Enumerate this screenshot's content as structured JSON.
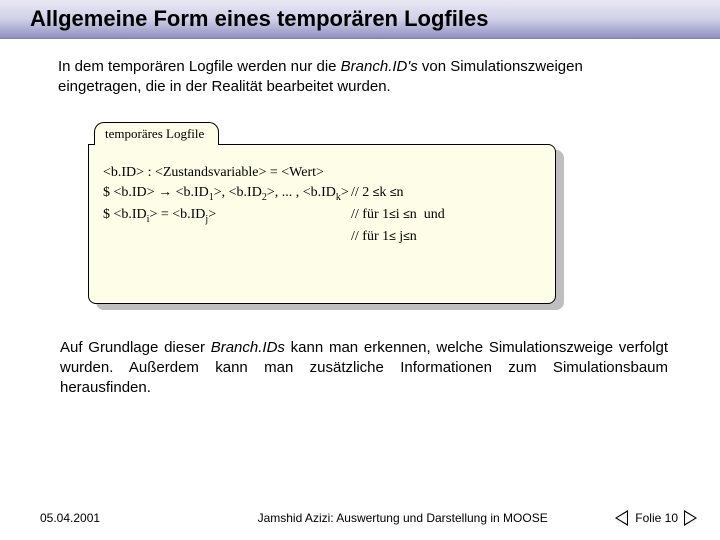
{
  "title": "Allgemeine Form eines temporären Logfiles",
  "intro": {
    "part1": "In dem temporären Logfile werden nur die ",
    "italic": "Branch.ID's",
    "part2": " von Simulationszweigen eingetragen, die in der Realität bearbeitet wurden."
  },
  "file": {
    "tab": "temporäres Logfile",
    "line1": "<b.ID> : <Zustandsvariable> = <Wert>",
    "line2_left": "$ <b.ID> → <b.ID₁>, <b.ID₂>, ... , <b.IDₖ>",
    "line2_right": "// 2 ≤ k ≤ n",
    "line3_left": "$ <b.IDᵢ> = <b.IDⱼ>",
    "line3_right": "// für 1 ≤ i ≤ n  und",
    "line4_right": "// für 1 ≤ j ≤ n"
  },
  "outro": {
    "part1": "Auf Grundlage dieser ",
    "italic": "Branch.IDs",
    "part2": " kann man erkennen, welche Simulationszweige verfolgt wurden. Außerdem kann man zusätzliche Informationen zum Simulationsbaum herausfinden."
  },
  "footer": {
    "date": "05.04.2001",
    "center": "Jamshid Azizi: Auswertung und Darstellung in MOOSE",
    "page": "Folie 10"
  }
}
